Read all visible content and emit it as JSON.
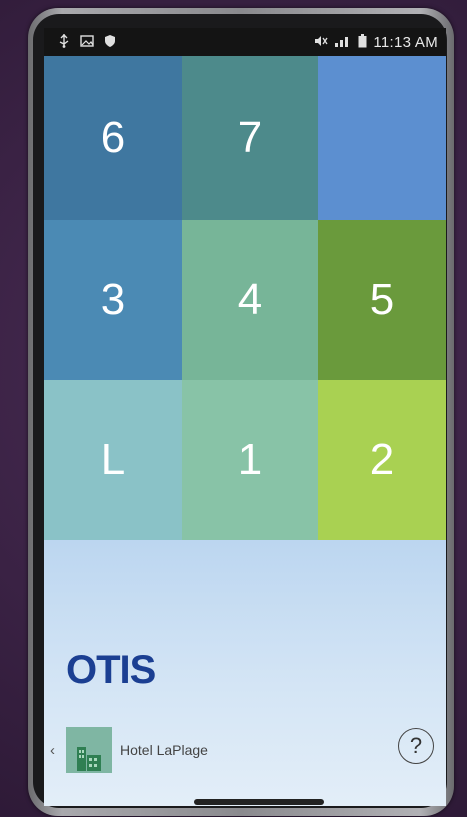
{
  "status_bar": {
    "time": "11:13 AM",
    "left_icons": [
      "usb-icon",
      "image-icon",
      "shield-icon"
    ],
    "right_icons": [
      "mute-icon",
      "signal-icon",
      "battery-icon"
    ]
  },
  "floors": [
    {
      "label": "6",
      "color": "#3f77a0"
    },
    {
      "label": "7",
      "color": "#4d8a8b"
    },
    {
      "label": "",
      "color": "#5c8fd0"
    },
    {
      "label": "3",
      "color": "#4b8ab4"
    },
    {
      "label": "4",
      "color": "#77b598"
    },
    {
      "label": "5",
      "color": "#6a9a3c"
    },
    {
      "label": "L",
      "color": "#8ac2c7"
    },
    {
      "label": "1",
      "color": "#88c3a7"
    },
    {
      "label": "2",
      "color": "#a9d152"
    }
  ],
  "brand": {
    "logo_text": "OTIS",
    "logo_color": "#1b3f92"
  },
  "footer": {
    "hotel_name": "Hotel LaPlage",
    "back_label": "‹",
    "help_label": "?"
  }
}
